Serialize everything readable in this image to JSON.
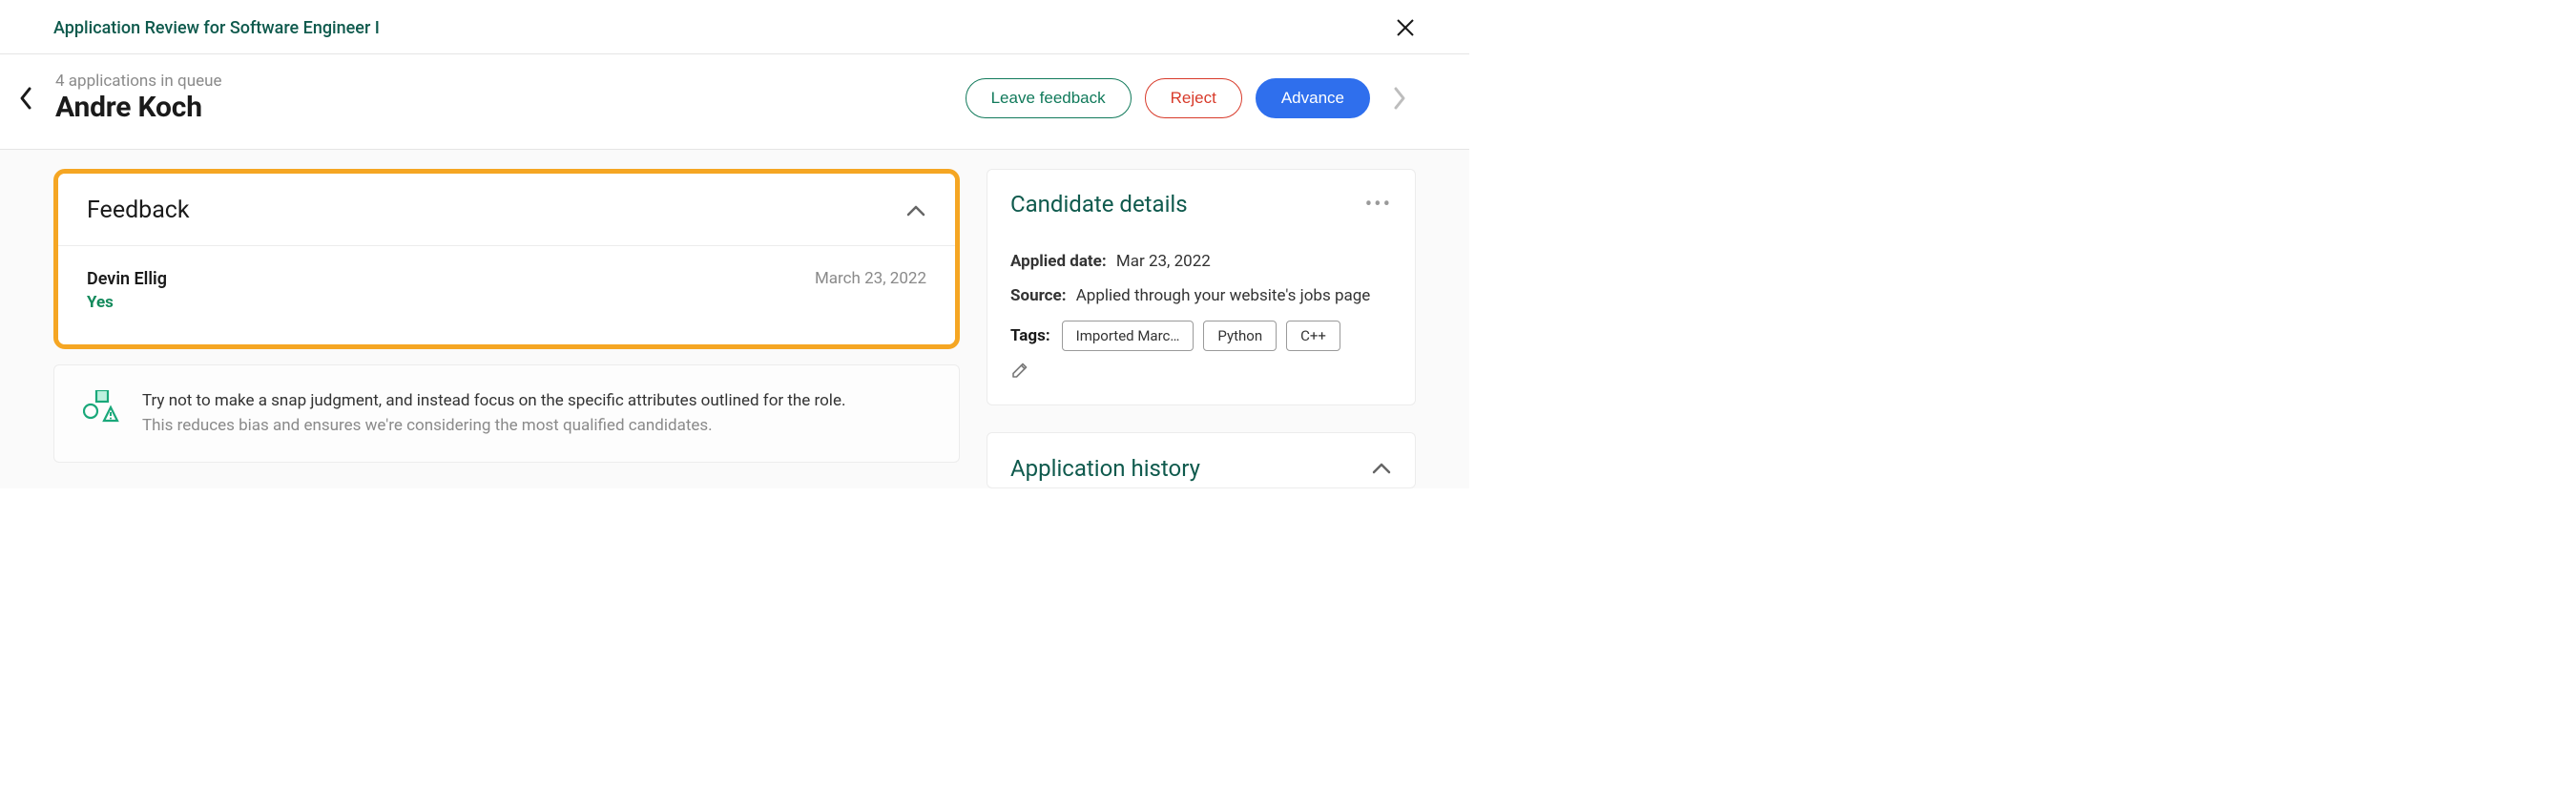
{
  "topbar": {
    "title": "Application Review for Software Engineer I"
  },
  "header": {
    "queue_text": "4 applications in queue",
    "candidate_name": "Andre Koch",
    "buttons": {
      "feedback": "Leave feedback",
      "reject": "Reject",
      "advance": "Advance"
    }
  },
  "feedback_card": {
    "title": "Feedback",
    "entries": [
      {
        "reviewer": "Devin Ellig",
        "verdict": "Yes",
        "date": "March 23, 2022"
      }
    ]
  },
  "tip": {
    "line1": "Try not to make a snap judgment, and instead focus on the specific attributes outlined for the role.",
    "line2": "This reduces bias and ensures we're considering the most qualified candidates."
  },
  "details": {
    "title": "Candidate details",
    "applied_label": "Applied date:",
    "applied_value": "Mar 23, 2022",
    "source_label": "Source:",
    "source_value": "Applied through your website's jobs page",
    "tags_label": "Tags:",
    "tags": [
      "Imported Marc…",
      "Python",
      "C++"
    ]
  },
  "history": {
    "title": "Application history"
  }
}
